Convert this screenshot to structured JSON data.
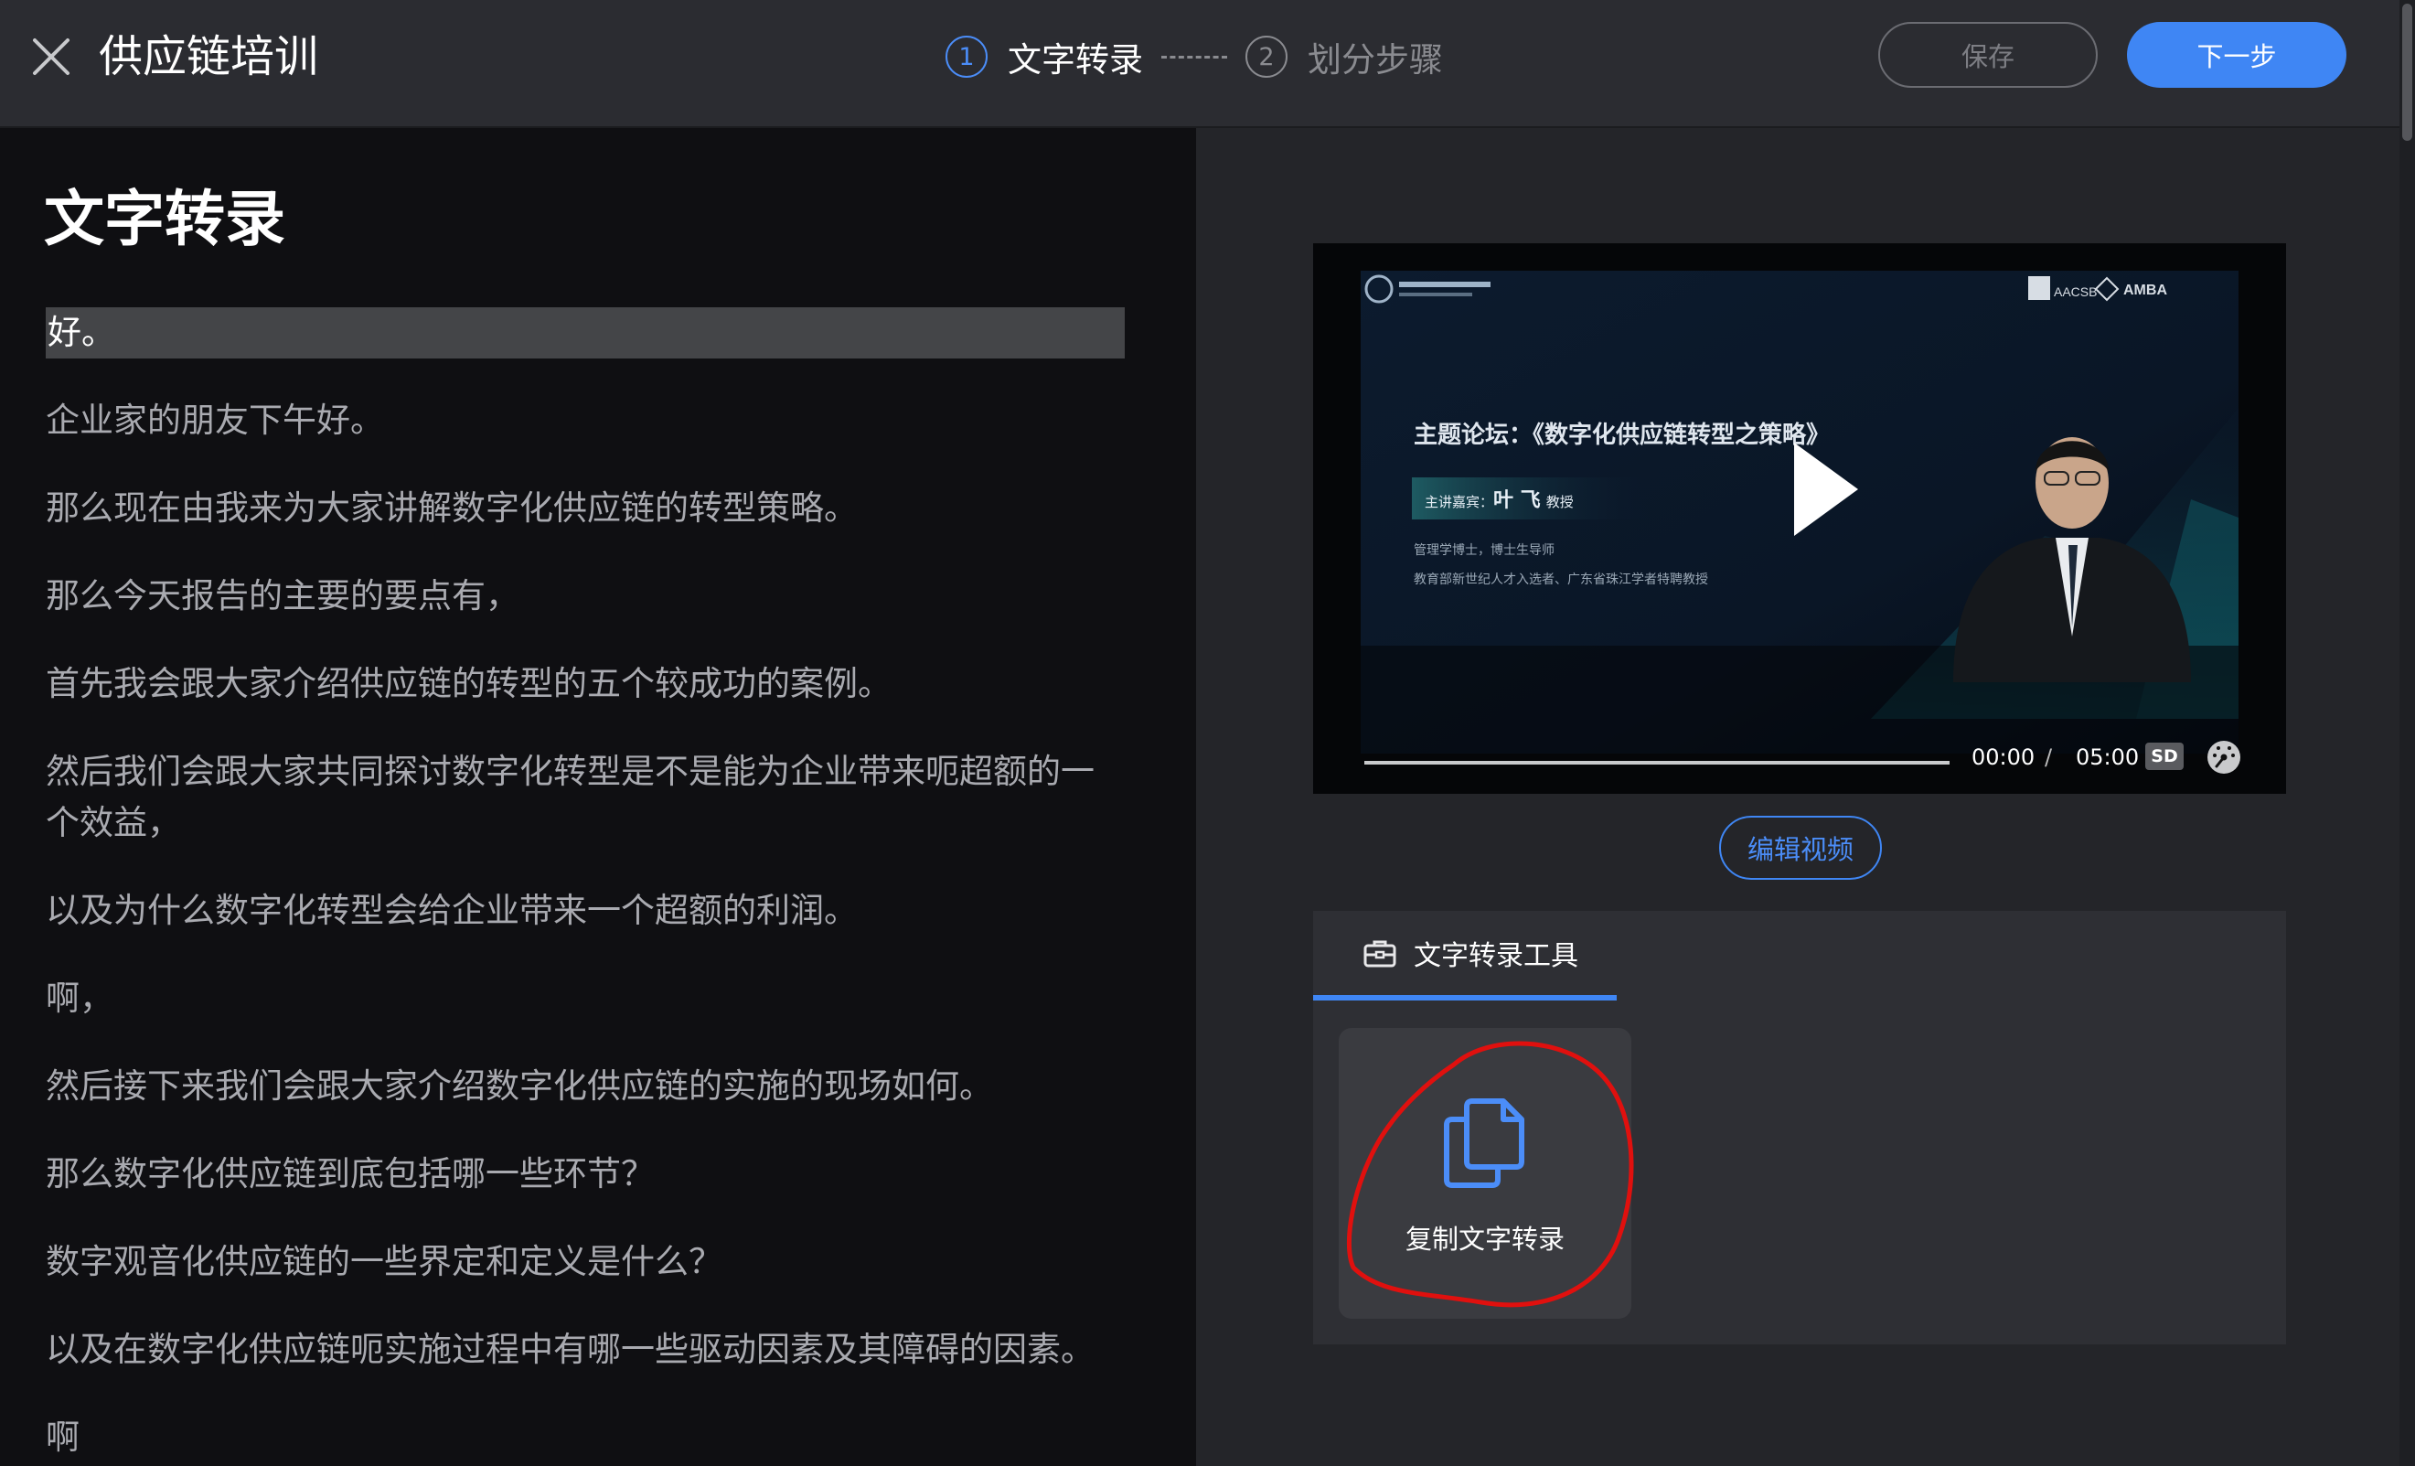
{
  "header": {
    "title": "供应链培训",
    "steps": [
      {
        "number": "1",
        "label": "文字转录"
      },
      {
        "number": "2",
        "label": "划分步骤"
      }
    ],
    "save_label": "保存",
    "next_label": "下一步"
  },
  "transcript": {
    "title": "文字转录",
    "lines": [
      "好。",
      "企业家的朋友下午好。",
      "那么现在由我来为大家讲解数字化供应链的转型策略。",
      "那么今天报告的主要的要点有，",
      "首先我会跟大家介绍供应链的转型的五个较成功的案例。",
      "然后我们会跟大家共同探讨数字化转型是不是能为企业带来呃超额的一个效益，",
      "以及为什么数字化转型会给企业带来一个超额的利润。",
      "啊，",
      "然后接下来我们会跟大家介绍数字化供应链的实施的现场如何。",
      "那么数字化供应链到底包括哪一些环节？",
      "数字观音化供应链的一些界定和定义是什么？",
      "以及在数字化供应链呃实施过程中有哪一些驱动因素及其障碍的因素。",
      "啊"
    ],
    "highlighted_index": 0
  },
  "video": {
    "slide_title": "主题论坛：《数字化供应链转型之策略》",
    "speaker_prefix": "主讲嘉宾：",
    "speaker_name": "叶 飞",
    "speaker_suffix": "教授",
    "speaker_line1": "管理学博士，博士生导师",
    "speaker_line2": "教育部新世纪人才入选者、广东省珠江学者特聘教授",
    "badge_left": "AACSB",
    "badge_right": "AMBA",
    "current_time": "00:00",
    "separator": "/",
    "total_time": "05:00",
    "quality": "SD",
    "progress": 0
  },
  "edit_video_label": "编辑视频",
  "tools": {
    "tab_label": "文字转录工具",
    "copy_label": "复制文字转录"
  },
  "colors": {
    "accent": "#3f86f4",
    "annotation": "#e0100e"
  }
}
